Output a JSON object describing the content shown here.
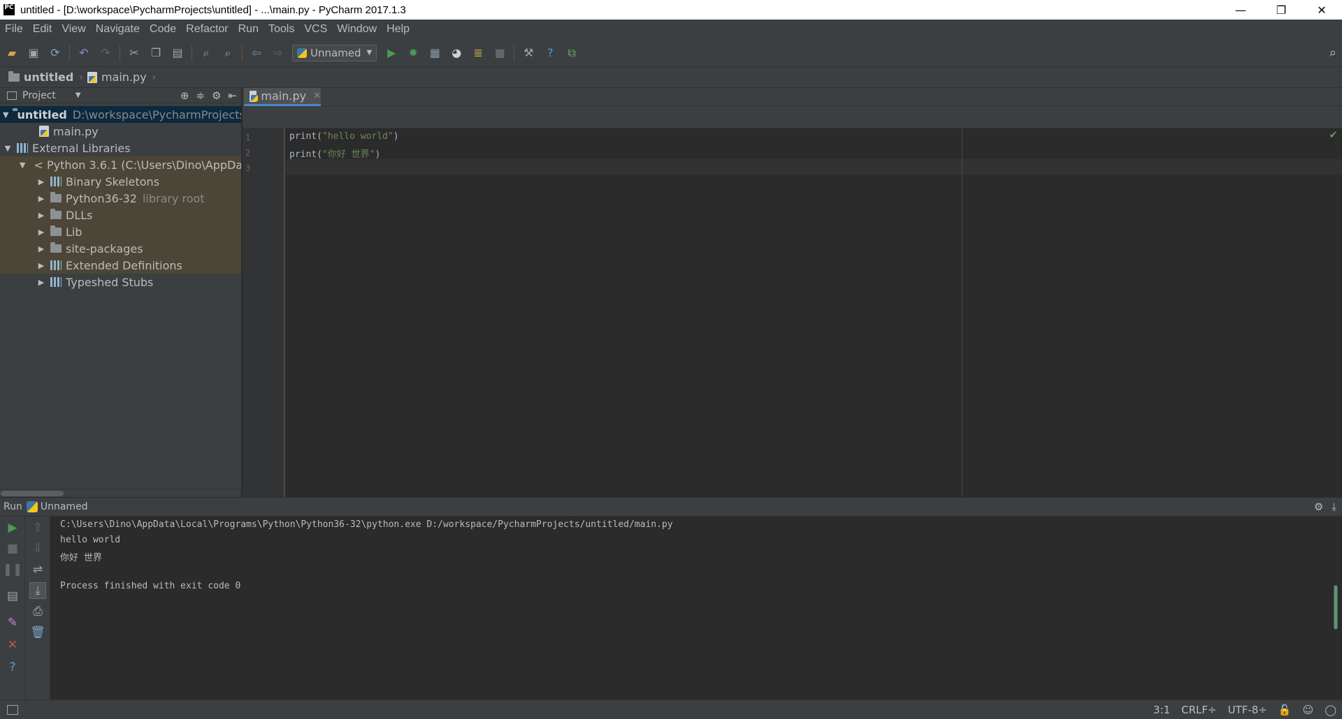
{
  "window": {
    "app_icon_label": "PC",
    "title": "untitled - [D:\\workspace\\PycharmProjects\\untitled] - ...\\main.py - PyCharm 2017.1.3",
    "minimize": "—",
    "restore": "❐",
    "close": "✕"
  },
  "menu": [
    "File",
    "Edit",
    "View",
    "Navigate",
    "Code",
    "Refactor",
    "Run",
    "Tools",
    "VCS",
    "Window",
    "Help"
  ],
  "toolbar": {
    "run_config": "Unnamed"
  },
  "breadcrumb": {
    "project": "untitled",
    "file": "main.py"
  },
  "project_panel": {
    "header": "Project",
    "tree": [
      {
        "label": "untitled",
        "path": "D:\\workspace\\PycharmProjects"
      },
      {
        "label": "main.py"
      },
      {
        "label": "External Libraries"
      },
      {
        "label": "< Python 3.6.1 (C:\\Users\\Dino\\AppData"
      },
      {
        "label": "Binary Skeletons"
      },
      {
        "label": "Python36-32",
        "note": "library root"
      },
      {
        "label": "DLLs"
      },
      {
        "label": "Lib"
      },
      {
        "label": "site-packages"
      },
      {
        "label": "Extended Definitions"
      },
      {
        "label": "Typeshed Stubs"
      }
    ]
  },
  "editor": {
    "tab": "main.py",
    "lines": [
      {
        "num": "1",
        "fn": "print",
        "open": "(",
        "str": "\"hello world\"",
        "close": ")"
      },
      {
        "num": "2",
        "fn": "print",
        "open": "(",
        "str": "\"你好 世界\"",
        "close": ")"
      },
      {
        "num": "3"
      }
    ]
  },
  "run_panel": {
    "label": "Run",
    "config": "Unnamed",
    "output": [
      "C:\\Users\\Dino\\AppData\\Local\\Programs\\Python\\Python36-32\\python.exe D:/workspace/PycharmProjects/untitled/main.py",
      "hello world",
      "你好 世界",
      "",
      "Process finished with exit code 0"
    ]
  },
  "status": {
    "position": "3:1",
    "line_sep": "CRLF÷",
    "encoding": "UTF-8÷"
  },
  "colors": {
    "background": "#3c3f41",
    "editor_bg": "#2b2b2b",
    "string": "#6a8759",
    "selection": "#0d293e",
    "run_green": "#499c54",
    "accent_blue": "#4a88c7"
  }
}
